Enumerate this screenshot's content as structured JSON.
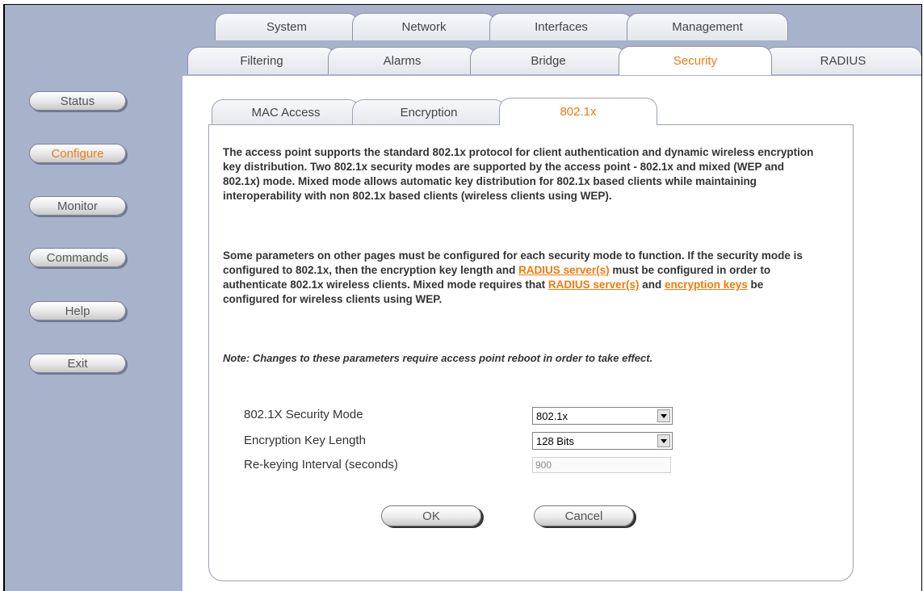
{
  "top_tabs": [
    "System",
    "Network",
    "Interfaces",
    "Management"
  ],
  "second_tabs": [
    "Filtering",
    "Alarms",
    "Bridge",
    "Security",
    "RADIUS"
  ],
  "sidebar": {
    "items": [
      "Status",
      "Configure",
      "Monitor",
      "Commands",
      "Help",
      "Exit"
    ],
    "active": "Configure"
  },
  "subtabs": [
    "MAC Access",
    "Encryption",
    "802.1x"
  ],
  "content": {
    "p1": "The access point supports the standard 802.1x protocol for client authentication and dynamic wireless encryption key distribution. Two 802.1x security modes are supported by the access point - 802.1x and mixed (WEP and 802.1x) mode. Mixed mode allows automatic key distribution for 802.1x based clients while maintaining interoperability with non 802.1x based clients (wireless clients using WEP).",
    "p2_a": "Some parameters on other pages must be configured for each security mode to function. If the security mode is configured to 802.1x, then the encryption key length and ",
    "p2_link1": "RADIUS server(s)",
    "p2_b": " must be configured in order to authenticate 802.1x wireless clients. Mixed mode requires that ",
    "p2_link2": "RADIUS server(s)",
    "p2_c": " and ",
    "p2_link3": "encryption keys",
    "p2_d": " be configured for wireless clients using WEP.",
    "note": "Note: Changes to these parameters require access point reboot in order to take effect."
  },
  "form": {
    "mode_label": "802.1X Security Mode",
    "mode_value": "802.1x",
    "keylen_label": "Encryption Key Length",
    "keylen_value": "128 Bits",
    "rekey_label": "Re-keying Interval (seconds)",
    "rekey_value": "900"
  },
  "buttons": {
    "ok": "OK",
    "cancel": "Cancel"
  },
  "colors": {
    "accent": "#f07a0c",
    "sidebar_bg": "#a7b2cb"
  }
}
